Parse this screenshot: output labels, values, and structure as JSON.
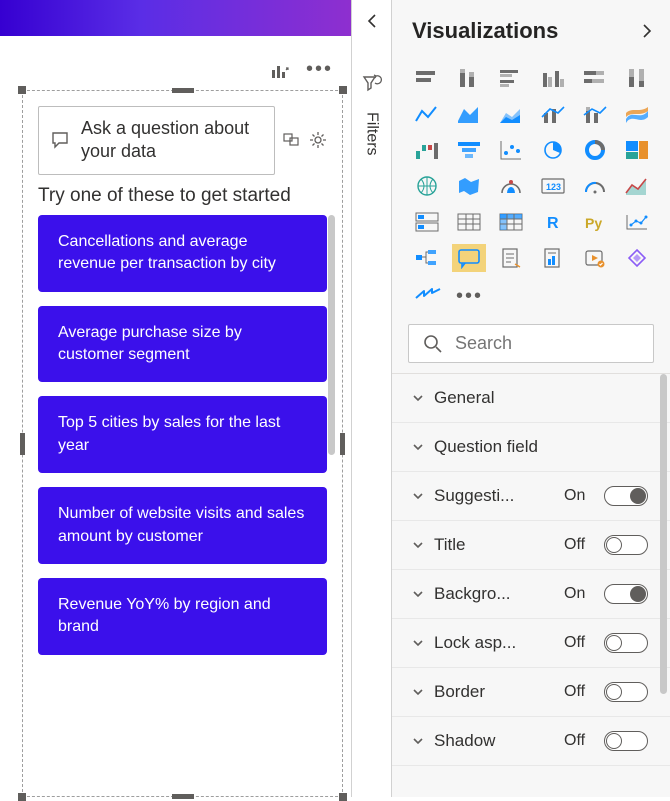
{
  "canvas": {
    "ask_placeholder": "Ask a question about your data",
    "try_heading": "Try one of these to get started",
    "suggestions": [
      "Cancellations and average revenue per transaction by city",
      "Average purchase size by customer segment",
      "Top 5 cities by sales for the last year",
      "Number of website visits and sales amount by customer",
      "Revenue YoY% by region and brand"
    ]
  },
  "rail": {
    "filters_label": "Filters"
  },
  "panel": {
    "title": "Visualizations",
    "search_placeholder": "Search",
    "selected_visual": "qna",
    "visuals": [
      "stacked-bar",
      "stacked-column",
      "clustered-bar",
      "clustered-column",
      "stacked-bar-100",
      "stacked-column-100",
      "line",
      "area",
      "stacked-area",
      "line-clustered-column",
      "line-stacked-column",
      "ribbon",
      "waterfall",
      "funnel",
      "scatter",
      "pie",
      "donut",
      "treemap",
      "map",
      "filled-map",
      "arcgis-map",
      "gauge",
      "card",
      "kpi",
      "multirow-card",
      "table",
      "matrix",
      "r",
      "python",
      "key-influencers",
      "decomposition-tree",
      "qna",
      "paginated-report",
      "smart-narrative",
      "power-automate",
      "power-apps"
    ],
    "format_sections": [
      {
        "label": "General",
        "toggle": null
      },
      {
        "label": "Question field",
        "toggle": null
      },
      {
        "label": "Suggesti...",
        "toggle": {
          "state": "On"
        }
      },
      {
        "label": "Title",
        "toggle": {
          "state": "Off"
        }
      },
      {
        "label": "Backgro...",
        "toggle": {
          "state": "On"
        }
      },
      {
        "label": "Lock asp...",
        "toggle": {
          "state": "Off"
        }
      },
      {
        "label": "Border",
        "toggle": {
          "state": "Off"
        }
      },
      {
        "label": "Shadow",
        "toggle": {
          "state": "Off"
        }
      }
    ]
  }
}
